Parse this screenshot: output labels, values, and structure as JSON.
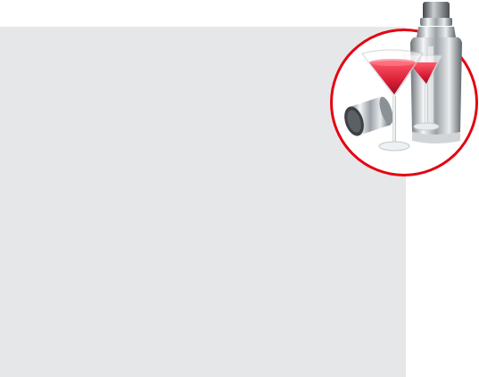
{
  "page": {
    "background_color": "#ffffff",
    "panel_color": "#e6e7e8",
    "badge_ring_color": "#e30613"
  },
  "illustration": {
    "subject": "cocktail-set",
    "icons": [
      "cocktail-shaker-icon",
      "martini-glass-icon",
      "martini-glass-icon",
      "shaker-cap-icon"
    ],
    "liquid_color": "#e0283c"
  }
}
